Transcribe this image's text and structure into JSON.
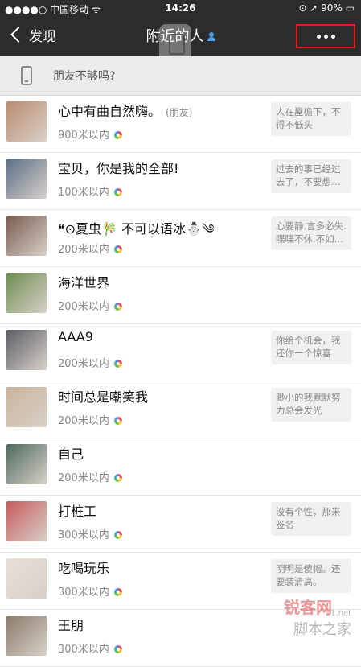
{
  "status": {
    "carrier": "●●●●○ 中国移动 ᯤ",
    "time": "14:26",
    "battery": "⊙ ➚ 90% ▭"
  },
  "nav": {
    "back_label": "发现",
    "title": "附近的人"
  },
  "banner": {
    "text": "朋友不够吗?"
  },
  "people": [
    {
      "name": "心中有曲自然嗨。",
      "tag": "(朋友)",
      "distance": "900米以内",
      "signature": "人在屋檐下，不得不低头",
      "avatar_color": "#b98b6c"
    },
    {
      "name": "宝贝，你是我的全部!",
      "tag": "",
      "distance": "100米以内",
      "signature": "过去的事已经过去了，不要想…",
      "avatar_color": "#5a6f88"
    },
    {
      "name": "❝⊙夏虫🎋 不可以语冰⛄༄",
      "tag": "",
      "distance": "200米以内",
      "signature": "心要静.言多必失.喋喋不休.不如…",
      "avatar_color": "#7a5c50"
    },
    {
      "name": "海洋世界",
      "tag": "",
      "distance": "200米以内",
      "signature": "",
      "avatar_color": "#6b8e4e"
    },
    {
      "name": "AAA9",
      "tag": "",
      "distance": "200米以内",
      "signature": "你给个机会，我还你一个惊喜",
      "avatar_color": "#5c5f66"
    },
    {
      "name": "时间总是嘲笑我",
      "tag": "",
      "distance": "200米以内",
      "signature": "渺小的我默默努力总会发光",
      "avatar_color": "#c9b39a"
    },
    {
      "name": "自己",
      "tag": "",
      "distance": "200米以内",
      "signature": "",
      "avatar_color": "#4e6a5e"
    },
    {
      "name": "打桩工",
      "tag": "",
      "distance": "300米以内",
      "signature": "没有个性，那来签名",
      "avatar_color": "#c65a5a"
    },
    {
      "name": "吃喝玩乐",
      "tag": "",
      "distance": "300米以内",
      "signature": "明明是傻帽。还要装清高。",
      "avatar_color": "#e8e0d8"
    },
    {
      "name": "王朋",
      "tag": "",
      "distance": "300米以内",
      "signature": "",
      "avatar_color": "#8a7a6a"
    }
  ],
  "watermark": {
    "brand": "锐客网",
    "site": "脚本之家",
    "url": "51.net"
  }
}
